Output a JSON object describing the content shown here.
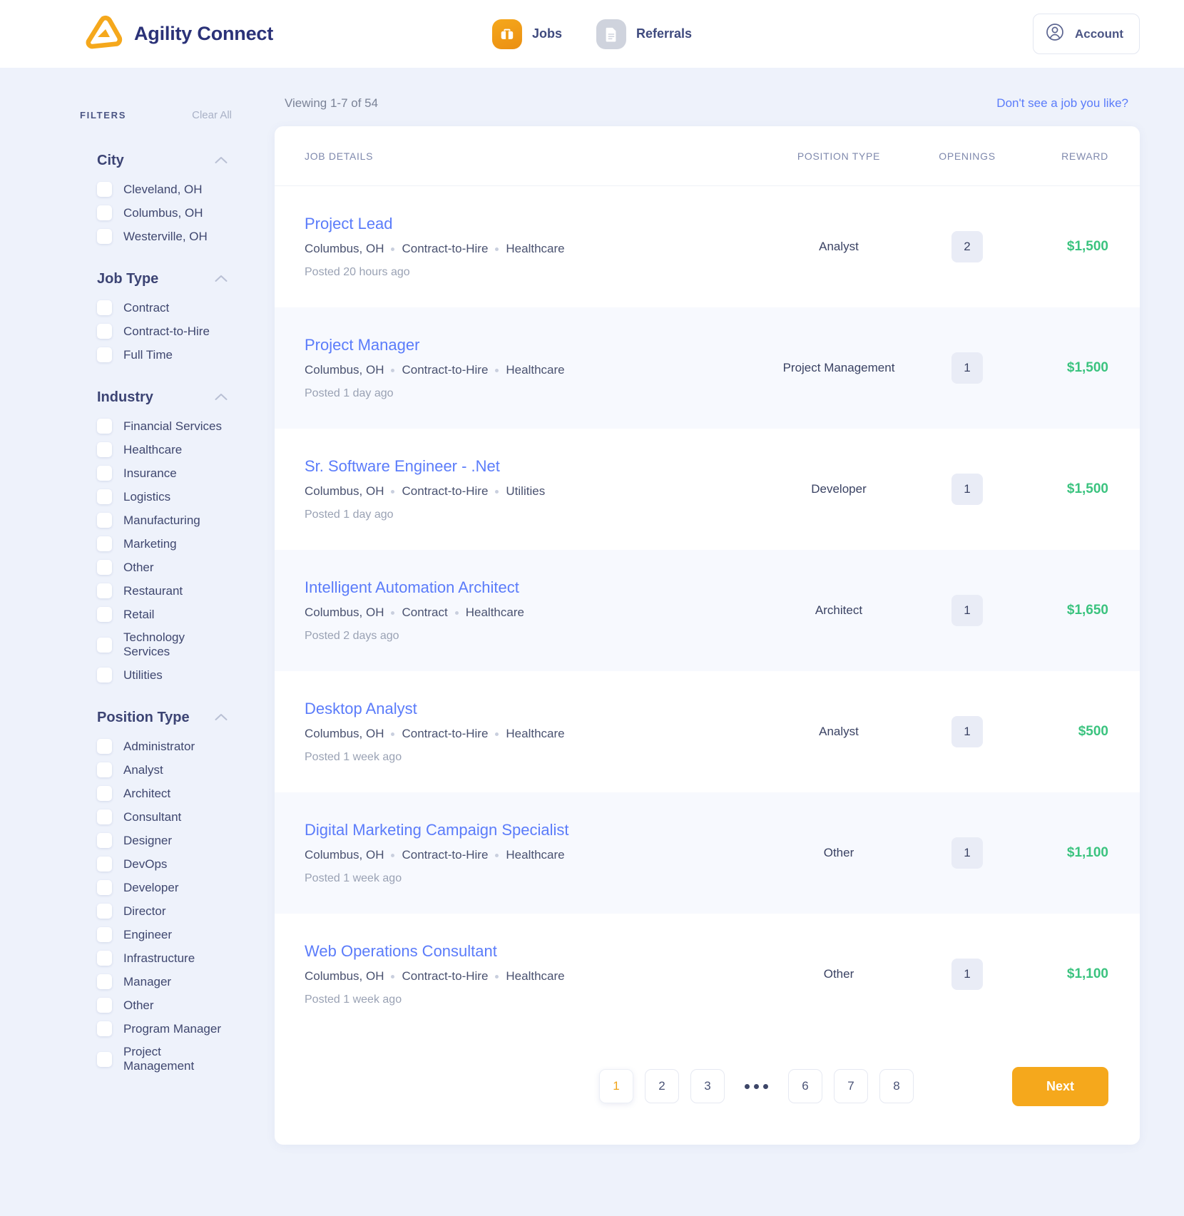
{
  "header": {
    "brand": "Agility Connect",
    "nav": [
      {
        "label": "Jobs",
        "icon": "briefcase-icon",
        "active": true
      },
      {
        "label": "Referrals",
        "icon": "document-icon",
        "active": false
      }
    ],
    "account_label": "Account",
    "account_icon": "user-circle-icon"
  },
  "sidebar": {
    "title": "FILTERS",
    "clear_all": "Clear All",
    "groups": [
      {
        "title": "City",
        "collapse_icon": "chevron-up-icon",
        "options": [
          "Cleveland, OH",
          "Columbus, OH",
          "Westerville, OH"
        ]
      },
      {
        "title": "Job Type",
        "collapse_icon": "chevron-up-icon",
        "options": [
          "Contract",
          "Contract-to-Hire",
          "Full Time"
        ]
      },
      {
        "title": "Industry",
        "collapse_icon": "chevron-up-icon",
        "options": [
          "Financial Services",
          "Healthcare",
          "Insurance",
          "Logistics",
          "Manufacturing",
          "Marketing",
          "Other",
          "Restaurant",
          "Retail",
          "Technology Services",
          "Utilities"
        ]
      },
      {
        "title": "Position Type",
        "collapse_icon": "chevron-up-icon",
        "options": [
          "Administrator",
          "Analyst",
          "Architect",
          "Consultant",
          "Designer",
          "DevOps",
          "Developer",
          "Director",
          "Engineer",
          "Infrastructure",
          "Manager",
          "Other",
          "Program Manager",
          "Project Management"
        ]
      }
    ]
  },
  "main": {
    "viewing": "Viewing 1-7 of 54",
    "no_job_link": "Don't see a job you like?",
    "columns": {
      "details": "JOB DETAILS",
      "position_type": "POSITION TYPE",
      "openings": "OPENINGS",
      "reward": "REWARD"
    },
    "jobs": [
      {
        "title": "Project Lead",
        "location": "Columbus, OH",
        "job_type": "Contract-to-Hire",
        "industry": "Healthcare",
        "posted": "Posted 20 hours ago",
        "position_type": "Analyst",
        "openings": "2",
        "reward": "$1,500"
      },
      {
        "title": "Project Manager",
        "location": "Columbus, OH",
        "job_type": "Contract-to-Hire",
        "industry": "Healthcare",
        "posted": "Posted 1 day ago",
        "position_type": "Project Management",
        "openings": "1",
        "reward": "$1,500"
      },
      {
        "title": "Sr. Software Engineer - .Net",
        "location": "Columbus, OH",
        "job_type": "Contract-to-Hire",
        "industry": "Utilities",
        "posted": "Posted 1 day ago",
        "position_type": "Developer",
        "openings": "1",
        "reward": "$1,500"
      },
      {
        "title": "Intelligent Automation Architect",
        "location": "Columbus, OH",
        "job_type": "Contract",
        "industry": "Healthcare",
        "posted": "Posted 2 days ago",
        "position_type": "Architect",
        "openings": "1",
        "reward": "$1,650"
      },
      {
        "title": "Desktop Analyst",
        "location": "Columbus, OH",
        "job_type": "Contract-to-Hire",
        "industry": "Healthcare",
        "posted": "Posted 1 week ago",
        "position_type": "Analyst",
        "openings": "1",
        "reward": "$500"
      },
      {
        "title": "Digital Marketing Campaign Specialist",
        "location": "Columbus, OH",
        "job_type": "Contract-to-Hire",
        "industry": "Healthcare",
        "posted": "Posted 1 week ago",
        "position_type": "Other",
        "openings": "1",
        "reward": "$1,100"
      },
      {
        "title": "Web Operations Consultant",
        "location": "Columbus, OH",
        "job_type": "Contract-to-Hire",
        "industry": "Healthcare",
        "posted": "Posted 1 week ago",
        "position_type": "Other",
        "openings": "1",
        "reward": "$1,100"
      }
    ],
    "pagination": {
      "pages": [
        "1",
        "2",
        "3",
        "…",
        "6",
        "7",
        "8"
      ],
      "current": "1",
      "next_label": "Next"
    }
  },
  "colors": {
    "brand_orange": "#f5a81c",
    "brand_navy": "#2b3278",
    "link_blue": "#5b7cfa",
    "reward_green": "#3bc37f",
    "page_bg": "#eef2fb"
  }
}
